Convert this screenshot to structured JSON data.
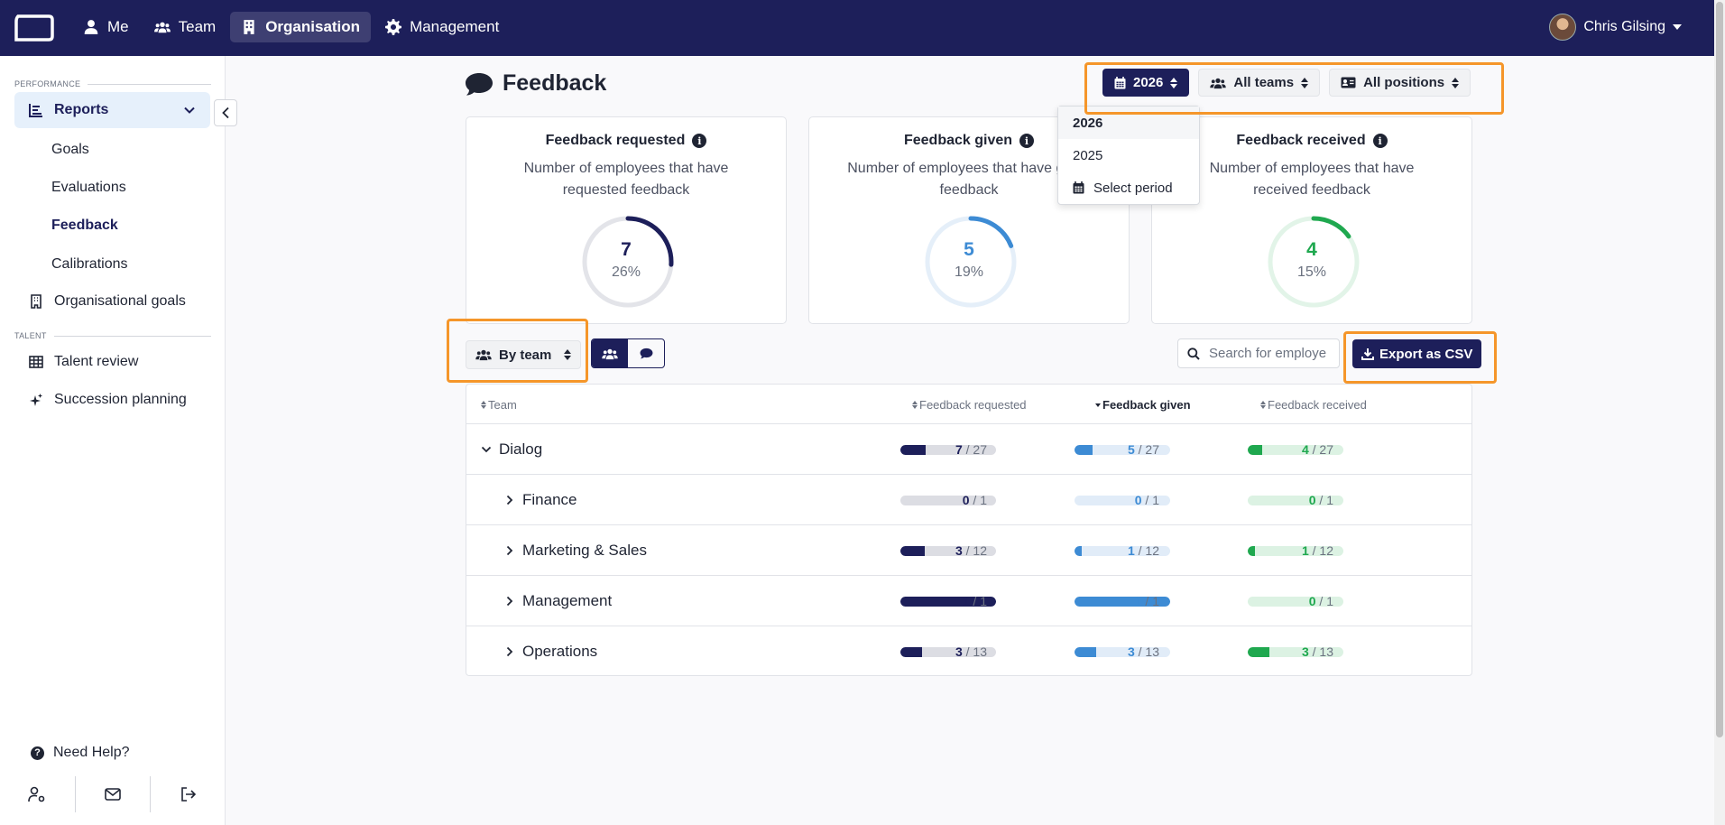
{
  "nav": {
    "items": [
      {
        "label": "Me"
      },
      {
        "label": "Team"
      },
      {
        "label": "Organisation"
      },
      {
        "label": "Management"
      }
    ],
    "user_name": "Chris Gilsing"
  },
  "sidebar": {
    "performance_label": "PERFORMANCE",
    "reports_label": "Reports",
    "sub_items": [
      "Goals",
      "Evaluations",
      "Feedback",
      "Calibrations"
    ],
    "org_goals_label": "Organisational goals",
    "talent_label": "TALENT",
    "talent_review_label": "Talent review",
    "succession_label": "Succession planning",
    "help_label": "Need Help?"
  },
  "page": {
    "title": "Feedback"
  },
  "filters": {
    "year": "2026",
    "teams": "All teams",
    "positions": "All positions"
  },
  "year_dropdown": {
    "options": [
      "2026",
      "2025"
    ],
    "select_period": "Select period"
  },
  "cards": [
    {
      "title": "Feedback requested",
      "desc": "Number of employees that have requested feedback",
      "value": "7",
      "pct_label": "26%",
      "fraction": 0.26,
      "color": "#1d1f5a",
      "track": "#e3e4e9"
    },
    {
      "title": "Feedback given",
      "desc": "Number of employees that have given feedback",
      "value": "5",
      "pct_label": "19%",
      "fraction": 0.19,
      "color": "#3d8bd4",
      "track": "#e5eff9"
    },
    {
      "title": "Feedback received",
      "desc": "Number of employees that have received feedback",
      "value": "4",
      "pct_label": "15%",
      "fraction": 0.15,
      "color": "#1fa84f",
      "track": "#e2f4e8"
    }
  ],
  "controls": {
    "group_by": "By team",
    "search_placeholder": "Search for employee",
    "export_label": "Export as CSV"
  },
  "table": {
    "columns": [
      "Team",
      "Feedback requested",
      "Feedback given",
      "Feedback received"
    ],
    "colors": {
      "requested": {
        "fill": "#1d1f5a",
        "track": "#dcdde3"
      },
      "given": {
        "fill": "#3d8bd4",
        "track": "#e1ecf8"
      },
      "received": {
        "fill": "#1fa84f",
        "track": "#dcf2e3"
      }
    },
    "rows": [
      {
        "name": "Dialog",
        "expanded": true,
        "level": 0,
        "requested": {
          "n": "7",
          "d": "27",
          "f": 0.26
        },
        "given": {
          "n": "5",
          "d": "27",
          "f": 0.19
        },
        "received": {
          "n": "4",
          "d": "27",
          "f": 0.15
        }
      },
      {
        "name": "Finance",
        "expanded": false,
        "level": 1,
        "requested": {
          "n": "0",
          "d": "1",
          "f": 0
        },
        "given": {
          "n": "0",
          "d": "1",
          "f": 0
        },
        "received": {
          "n": "0",
          "d": "1",
          "f": 0
        }
      },
      {
        "name": "Marketing & Sales",
        "expanded": false,
        "level": 1,
        "requested": {
          "n": "3",
          "d": "12",
          "f": 0.25
        },
        "given": {
          "n": "1",
          "d": "12",
          "f": 0.08
        },
        "received": {
          "n": "1",
          "d": "12",
          "f": 0.08
        }
      },
      {
        "name": "Management",
        "expanded": false,
        "level": 1,
        "requested": {
          "n": "1",
          "d": "1",
          "f": 1
        },
        "given": {
          "n": "1",
          "d": "1",
          "f": 1
        },
        "received": {
          "n": "0",
          "d": "1",
          "f": 0
        }
      },
      {
        "name": "Operations",
        "expanded": false,
        "level": 1,
        "requested": {
          "n": "3",
          "d": "13",
          "f": 0.23
        },
        "given": {
          "n": "3",
          "d": "13",
          "f": 0.23
        },
        "received": {
          "n": "3",
          "d": "13",
          "f": 0.23
        }
      }
    ]
  }
}
